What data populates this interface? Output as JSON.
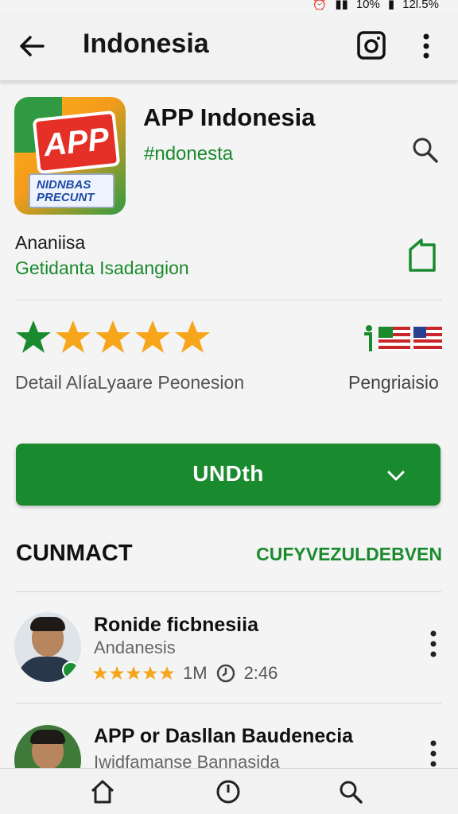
{
  "status": {
    "battery": "10%",
    "extra": "12l.5%"
  },
  "appbar": {
    "title": "Indonesia",
    "back_icon": "arrow-left-icon",
    "camera_icon": "camera-icon",
    "more_icon": "more-vert-icon"
  },
  "app": {
    "icon_badge": "APP",
    "icon_sign": "NIDNBAS PRECUNT",
    "name": "APP Indonesia",
    "tag": "#ndonesta"
  },
  "developer": {
    "name": "Ananiisa",
    "subtitle": "Getidanta Isadangion"
  },
  "rating": {
    "stars_filled": 5,
    "label": "Detail AlíaLyaare Peonesion",
    "right_label": "Pengriaisio",
    "first_star_color": "#1a8a2e",
    "star_color": "#f7a51b"
  },
  "install": {
    "label": "UNDth"
  },
  "section": {
    "title": "CUNMACT",
    "link": "CUFYVEZULDEBVEN"
  },
  "items": [
    {
      "title": "Ronide ficbnesiia",
      "subtitle": "Andanesis",
      "rating_stars": 5,
      "count": "1M",
      "duration": "2:46"
    },
    {
      "title": "APP or Dasllan Baudenecia",
      "subtitle": "Iwidfamanse Bannasida"
    }
  ],
  "colors": {
    "accent_green": "#1a8a2e",
    "star_yellow": "#f7a51b"
  }
}
